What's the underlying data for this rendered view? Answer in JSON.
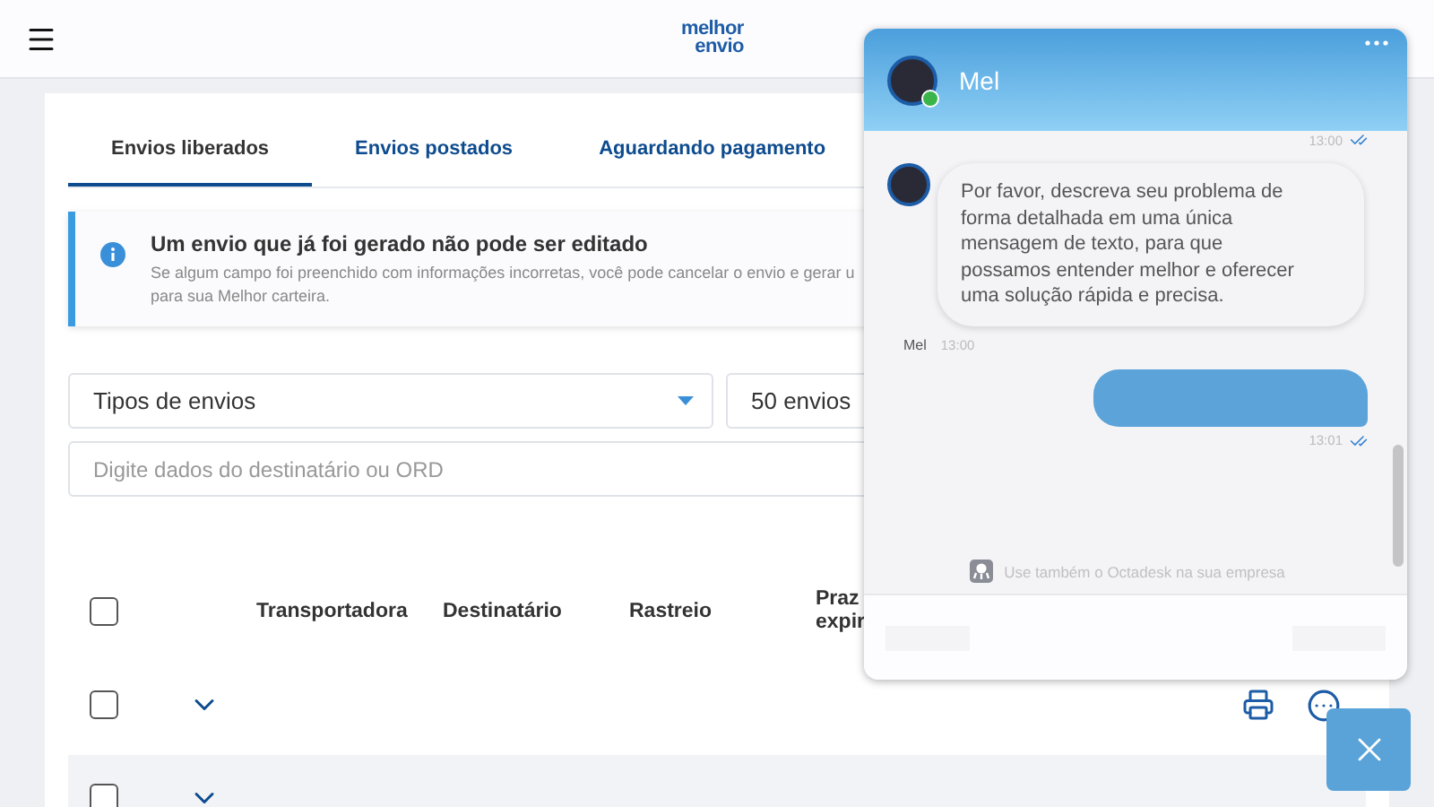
{
  "header": {
    "logo": [
      "melhor",
      "envio"
    ]
  },
  "tabs": [
    {
      "label": "Envios liberados",
      "selected": true
    },
    {
      "label": "Envios postados",
      "selected": false
    },
    {
      "label": "Aguardando pagamento",
      "selected": false
    }
  ],
  "alert": {
    "title": "Um envio que já foi gerado não pode ser editado",
    "lines": [
      "Se algum campo foi preenchido com informações incorretas, você pode cancelar o envio e gerar u",
      "para sua Melhor carteira."
    ]
  },
  "filters": {
    "type_select": "Tipos de envios",
    "count_select": "50 envios",
    "search": {
      "placeholder": "Digite dados do destinatário ou ORD"
    }
  },
  "table": {
    "select_all": {
      "checked": false
    },
    "columns": [
      {
        "lines": [
          "Transportadora"
        ]
      },
      {
        "lines": [
          "Destinatário"
        ]
      },
      {
        "lines": [
          "Rastreio"
        ]
      },
      {
        "lines": [
          "Praz",
          "expir"
        ]
      }
    ],
    "rows": [
      {
        "checked": false,
        "expanded": false,
        "highlighted": false
      },
      {
        "checked": false,
        "expanded": false,
        "highlighted": true
      }
    ]
  },
  "chat": {
    "agent": {
      "name": "Mel",
      "online": true
    },
    "messages": [
      {
        "kind": "receipt",
        "time": "13:00",
        "read": true
      },
      {
        "kind": "agent",
        "text": "Por favor, descreva seu problema de forma detalhada em uma única mensagem de texto, para que possamos entender melhor e oferecer uma solução rápida e precisa.",
        "sender": "Mel",
        "time": "13:00"
      },
      {
        "kind": "user",
        "time": "13:01",
        "read": true
      }
    ],
    "footer": "Use também o Octadesk na sua empresa"
  }
}
